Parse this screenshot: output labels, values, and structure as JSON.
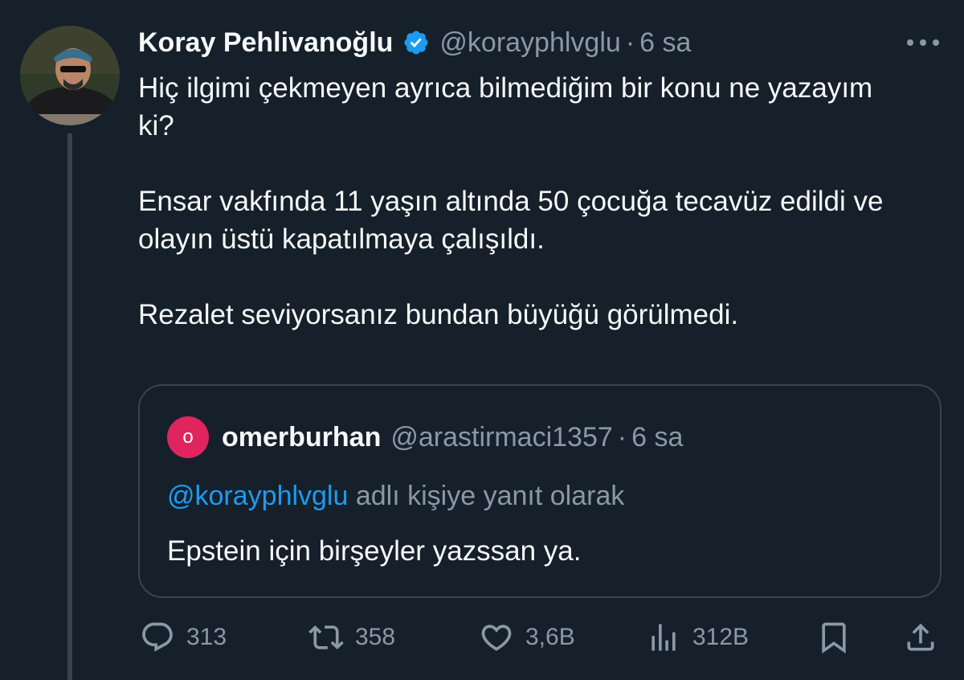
{
  "author": {
    "name": "Koray Pehlivanoğlu",
    "handle": "@korayphlvglu",
    "time": "6 sa"
  },
  "body": {
    "paragraphs": [
      "Hiç ilgimi çekmeyen ayrıca bilmediğim bir konu ne yazayım ki?",
      "Ensar vakfında 11 yaşın altında 50 çocuğa tecavüz edildi ve olayın üstü kapatılmaya çalışıldı.",
      "Rezalet seviyorsanız bundan büyüğü görülmedi."
    ]
  },
  "quote": {
    "avatar_letter": "o",
    "name": "omerburhan",
    "handle": "@arastirmaci1357",
    "time": "6 sa",
    "reply_mention": "@korayphlvglu",
    "reply_rest": "adlı kişiye yanıt olarak",
    "text": "Epstein için birşeyler yazssan ya."
  },
  "actions": {
    "replies": "313",
    "retweets": "358",
    "likes": "3,6B",
    "views": "312B"
  },
  "colors": {
    "background": "#15202b",
    "accent": "#1d9bf0",
    "muted": "#8b98a5",
    "border": "#38444d",
    "quote_avatar": "#e0245e"
  },
  "icons": [
    "verified-badge-icon",
    "more-icon",
    "reply-icon",
    "retweet-icon",
    "like-icon",
    "views-icon",
    "bookmark-icon",
    "share-icon"
  ]
}
